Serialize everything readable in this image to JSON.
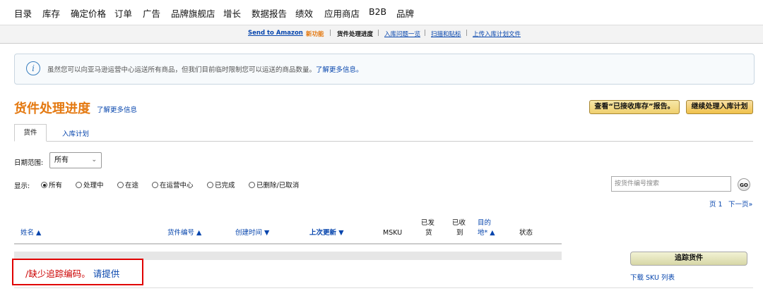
{
  "topnav": [
    "目录",
    "库存",
    "确定价格",
    "订单",
    "广告",
    "品牌旗舰店",
    "增长",
    "数据报告",
    "绩效",
    "应用商店",
    "B2B",
    "品牌"
  ],
  "subnav": {
    "send_to_amazon": "Send to Amazon",
    "new_badge": "新功能",
    "shipment_progress": "货件处理进度",
    "inbound_issues": "入库问题一览",
    "scan_label": "扫描和贴标",
    "upload_plan": "上传入库计划文件",
    "separator": "|"
  },
  "alert": {
    "icon": "i",
    "text": "虽然您可以向亚马逊运营中心运送所有商品，但我们目前临时限制您可以运送的商品数量。",
    "link": "了解更多信息。"
  },
  "page": {
    "title": "货件处理进度",
    "learn_more": "了解更多信息",
    "report_button": "查看“已接收库存”报告。",
    "continue_button": "继续处理入库计划"
  },
  "tabs": [
    "货件",
    "入库计划"
  ],
  "filters": {
    "date_range_label": "日期范围:",
    "date_range_value": "所有",
    "show_label": "显示:",
    "status_options": [
      {
        "label": "所有",
        "selected": true
      },
      {
        "label": "处理中",
        "selected": false
      },
      {
        "label": "在途",
        "selected": false
      },
      {
        "label": "在运营中心",
        "selected": false
      },
      {
        "label": "已完成",
        "selected": false
      },
      {
        "label": "已删除/已取消",
        "selected": false
      }
    ],
    "search_placeholder": "按货件编号搜索",
    "go_label": "GO"
  },
  "pager": {
    "page_text": "页 1",
    "next_text": "下一页»"
  },
  "table": {
    "headers": {
      "name": "姓名 ▲",
      "shipment_id": "货件编号 ▲",
      "created": "创建时间 ▼",
      "last_updated": "上次更新 ▼",
      "msku": "MSKU",
      "shipped_line1": "已发",
      "shipped_line2": "货",
      "received_line1": "已收",
      "received_line2": "到",
      "destination_line1": "目的",
      "destination_line2": "地* ▲",
      "status": "状态"
    },
    "row": {
      "missing_tracking": "/缺少追踪编码。",
      "please_provide": "请提供",
      "track_button": "追踪货件",
      "download_sku": "下载 SKU 列表"
    }
  }
}
